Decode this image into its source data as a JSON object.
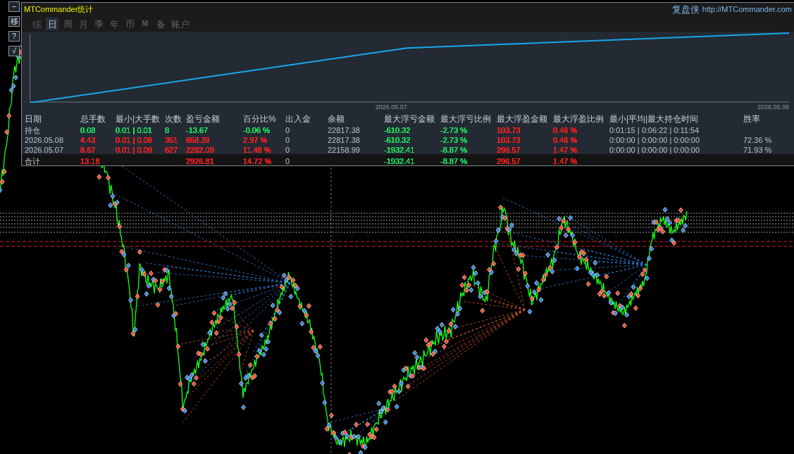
{
  "side_toolbar": [
    {
      "label": "−"
    },
    {
      "label": "移"
    },
    {
      "label": "?"
    },
    {
      "label": "√"
    }
  ],
  "panel": {
    "title": "MTCommander统计",
    "brand": "复盘侠",
    "link": "http://MTCommander.com",
    "tabs": [
      {
        "label": "综",
        "kind": "text",
        "selected": false
      },
      {
        "label": "日",
        "kind": "text",
        "selected": true
      },
      {
        "label": "周",
        "kind": "text",
        "selected": false
      },
      {
        "label": "月",
        "kind": "text",
        "selected": false
      },
      {
        "label": "季",
        "kind": "text",
        "selected": false
      },
      {
        "label": "年",
        "kind": "text",
        "selected": false
      },
      {
        "label": "币",
        "kind": "text",
        "selected": false
      },
      {
        "label": "M",
        "kind": "mini",
        "selected": false
      },
      {
        "label": "备",
        "kind": "text",
        "selected": false
      },
      {
        "label": "账户",
        "kind": "text",
        "selected": false
      }
    ]
  },
  "equity_chart": {
    "x_labels": [
      "2026.05.07",
      "2026.05.08"
    ]
  },
  "table": {
    "columns": [
      "日期",
      "总手数",
      "最小|大手数",
      "次数",
      "盈亏金额",
      "百分比%",
      "出入金",
      "余额",
      "最大浮亏金额",
      "最大浮亏比例",
      "最大浮盈金额",
      "最大浮盈比例",
      "最小|平均|最大持仓时间",
      "胜率"
    ],
    "rows": [
      {
        "date": "持仓",
        "lots": {
          "text": "0.08",
          "color": "#20e060"
        },
        "lot_range": {
          "text": "0.01 | 0.01",
          "color": "#20e060"
        },
        "trades": {
          "text": "8",
          "color": "#20e060"
        },
        "pnl": {
          "text": "-13.67",
          "color": "#20e060"
        },
        "pnl_pct": {
          "text": "-0.06 %",
          "color": "#20e060"
        },
        "cash_flow": "0",
        "balance": "22817.38",
        "max_float_loss": {
          "text": "-610.32",
          "color": "#20e060"
        },
        "max_float_loss_pct": {
          "text": "-2.73 %",
          "color": "#20e060"
        },
        "max_float_profit": {
          "text": "103.73",
          "color": "#ff2020"
        },
        "max_float_profit_pct": {
          "text": "0.46 %",
          "color": "#ff2020"
        },
        "hold_times": "0:01:15 | 0:06:22 | 0:11:54"
      },
      {
        "date": "2026.05.08",
        "lots": {
          "text": "4.43",
          "color": "#ff2020"
        },
        "lot_range": {
          "text": "0.01 | 0.08",
          "color": "#ff2020"
        },
        "trades": {
          "text": "351",
          "color": "#ff2020"
        },
        "pnl": {
          "text": "658.39",
          "color": "#ff2020"
        },
        "pnl_pct": {
          "text": "2.97 %",
          "color": "#ff2020"
        },
        "cash_flow": "0",
        "balance": "22817.38",
        "max_float_loss": {
          "text": "-610.32",
          "color": "#20e060"
        },
        "max_float_loss_pct": {
          "text": "-2.73 %",
          "color": "#20e060"
        },
        "max_float_profit": {
          "text": "103.73",
          "color": "#ff2020"
        },
        "max_float_profit_pct": {
          "text": "0.46 %",
          "color": "#ff2020"
        },
        "hold_times": "0:00:00 | 0:00:00 | 0:00:00",
        "win_rate": "72.36 %"
      },
      {
        "date": "2026.05.07",
        "lots": {
          "text": "8.67",
          "color": "#ff2020"
        },
        "lot_range": {
          "text": "0.01 | 0.09",
          "color": "#ff2020"
        },
        "trades": {
          "text": "627",
          "color": "#ff2020"
        },
        "pnl": {
          "text": "2282.09",
          "color": "#ff2020"
        },
        "pnl_pct": {
          "text": "11.48 %",
          "color": "#ff2020"
        },
        "cash_flow": "0",
        "balance": "22158.99",
        "max_float_loss": {
          "text": "-1932.41",
          "color": "#20e060"
        },
        "max_float_loss_pct": {
          "text": "-8.87 %",
          "color": "#20e060"
        },
        "max_float_profit": {
          "text": "296.57",
          "color": "#ff2020"
        },
        "max_float_profit_pct": {
          "text": "1.47 %",
          "color": "#ff2020"
        },
        "hold_times": "0:00:00 | 0:00:00 | 0:00:00",
        "win_rate": "71.93 %"
      }
    ],
    "total": {
      "date": "合计",
      "lots": {
        "text": "13.18",
        "color": "#ff2020"
      },
      "pnl": {
        "text": "2926.81",
        "color": "#ff2020"
      },
      "pnl_pct": {
        "text": "14.72 %",
        "color": "#ff2020"
      },
      "cash_flow": "0",
      "max_float_loss": {
        "text": "-1932.41",
        "color": "#20e060"
      },
      "max_float_loss_pct": {
        "text": "-8.87 %",
        "color": "#20e060"
      },
      "max_float_profit": {
        "text": "296.57",
        "color": "#ff2020"
      },
      "max_float_profit_pct": {
        "text": "1.47 %",
        "color": "#ff2020"
      }
    }
  }
}
